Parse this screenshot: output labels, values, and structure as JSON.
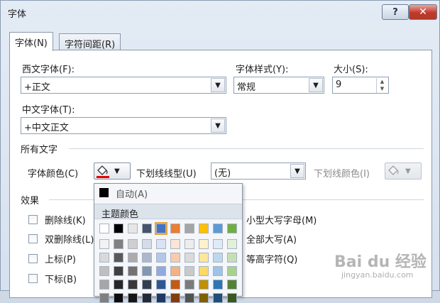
{
  "window": {
    "title": "字体",
    "help_label": "?",
    "close_label": "✕"
  },
  "tabs": [
    {
      "label": "字体(N)"
    },
    {
      "label": "字符间距(R)"
    }
  ],
  "latin_font": {
    "label": "西文字体(F):",
    "value": "+正文"
  },
  "font_style": {
    "label": "字体样式(Y):",
    "value": "常规"
  },
  "size": {
    "label": "大小(S):",
    "value": "9"
  },
  "asian_font": {
    "label": "中文字体(T):",
    "value": "+中文正文"
  },
  "all_text": {
    "section_label": "所有文字",
    "font_color_label": "字体颜色(C)",
    "underline_style_label": "下划线线型(U)",
    "underline_style_value": "(无)",
    "underline_color_label": "下划线颜色(I)"
  },
  "effects": {
    "section_label": "效果",
    "left": [
      "删除线(K)",
      "双删除线(L)",
      "上标(P)",
      "下标(B)"
    ],
    "right": [
      "小型大写字母(M)",
      "全部大写(A)",
      "等高字符(Q)"
    ]
  },
  "color_popup": {
    "auto_label": "自动(A)",
    "theme_label": "主题颜色",
    "theme_row": [
      "#ffffff",
      "#000000",
      "#e7e6e6",
      "#44546a",
      "#4472c4",
      "#ed7d31",
      "#a5a5a5",
      "#ffc000",
      "#5b9bd5",
      "#70ad47"
    ],
    "shade_columns": [
      [
        "#f2f2f2",
        "#d9d9d9",
        "#bfbfbf",
        "#a6a6a6",
        "#808080"
      ],
      [
        "#808080",
        "#595959",
        "#404040",
        "#262626",
        "#0d0d0d"
      ],
      [
        "#d0cece",
        "#aeaaaa",
        "#767171",
        "#3a3838",
        "#171616"
      ],
      [
        "#d6dce5",
        "#adb9ca",
        "#8497b0",
        "#333f50",
        "#222a35"
      ],
      [
        "#dae3f3",
        "#b4c7e7",
        "#8faadc",
        "#2f5597",
        "#203864"
      ],
      [
        "#fbe5d6",
        "#f8cbad",
        "#f4b183",
        "#c55a11",
        "#843c0c"
      ],
      [
        "#ededed",
        "#dbdbdb",
        "#c9c9c9",
        "#7b7b7b",
        "#525252"
      ],
      [
        "#fff2cc",
        "#ffe699",
        "#ffd966",
        "#bf9000",
        "#7f6000"
      ],
      [
        "#deebf7",
        "#bdd7ee",
        "#9dc3e6",
        "#2e75b6",
        "#1f4e79"
      ],
      [
        "#e2f0d9",
        "#c5e0b4",
        "#a9d18e",
        "#548235",
        "#385723"
      ]
    ]
  },
  "watermark": {
    "brand": "Bai du 经验",
    "url": "jingyan.baidu.com"
  }
}
